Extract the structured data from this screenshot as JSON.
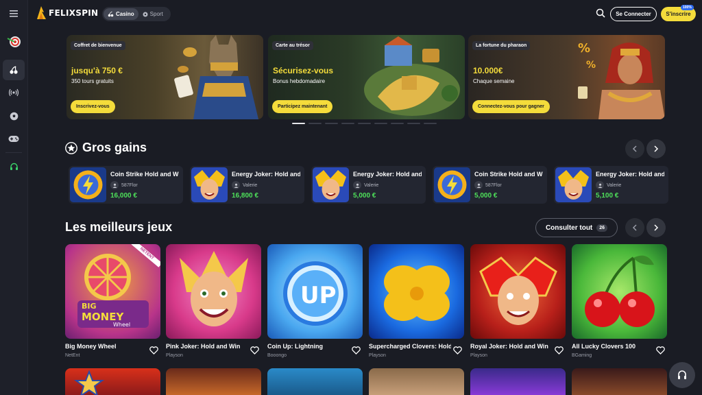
{
  "brand": {
    "name": "FELIXSPIN"
  },
  "switch": {
    "casino": "Casino",
    "sport": "Sport"
  },
  "auth": {
    "login": "Se Connecter",
    "signup": "S'inscrire",
    "badge": "100%"
  },
  "banners": [
    {
      "tag": "Coffret de bienvenue",
      "title": "jusqu'à 750 €",
      "subtitle": "350 tours gratuits",
      "cta": "Inscrivez-vous"
    },
    {
      "tag": "Carte au trésor",
      "title": "Sécurisez-vous",
      "subtitle": "Bonus hebdomadaire",
      "cta": "Participez maintenant"
    },
    {
      "tag": "La fortune du pharaon",
      "title": "10.000€",
      "subtitle": "Chaque semaine",
      "cta": "Connectez-vous pour gagner"
    }
  ],
  "big_wins": {
    "title": "Gros gains",
    "items": [
      {
        "game": "Coin Strike Hold and Win",
        "user": "587Flor",
        "amount": "16,000 €",
        "thumb": "coin"
      },
      {
        "game": "Energy Joker: Hold and Win",
        "user": "Valerie",
        "amount": "16,800 €",
        "thumb": "joker"
      },
      {
        "game": "Energy Joker: Hold and Win",
        "user": "Valerie",
        "amount": "5,000 €",
        "thumb": "joker"
      },
      {
        "game": "Coin Strike Hold and Win",
        "user": "587Flor",
        "amount": "5,000 €",
        "thumb": "coin"
      },
      {
        "game": "Energy Joker: Hold and Win",
        "user": "Valerie",
        "amount": "5,100 €",
        "thumb": "joker"
      }
    ]
  },
  "top_games": {
    "title": "Les meilleurs jeux",
    "consult": "Consulter tout",
    "count": "26",
    "items": [
      {
        "name": "Big Money Wheel",
        "provider": "NetEnt"
      },
      {
        "name": "Pink Joker: Hold and Win",
        "provider": "Playson"
      },
      {
        "name": "Coin Up: Lightning",
        "provider": "Booongo"
      },
      {
        "name": "Supercharged Clovers: Hold and Win",
        "provider": "Playson"
      },
      {
        "name": "Royal Joker: Hold and Win",
        "provider": "Playson"
      },
      {
        "name": "All Lucky Clovers 100",
        "provider": "BGaming"
      }
    ],
    "netent_ribbon": "NETENT",
    "thumb_texts": {
      "big": "BIG",
      "money": "MONEY",
      "wheel": "Wheel",
      "up": "UP"
    }
  },
  "colors": {
    "accent": "#f4dc3b",
    "win_green": "#4ee05a",
    "bg": "#1a1c24"
  },
  "carousel": {
    "slides": 9,
    "active": 1
  }
}
